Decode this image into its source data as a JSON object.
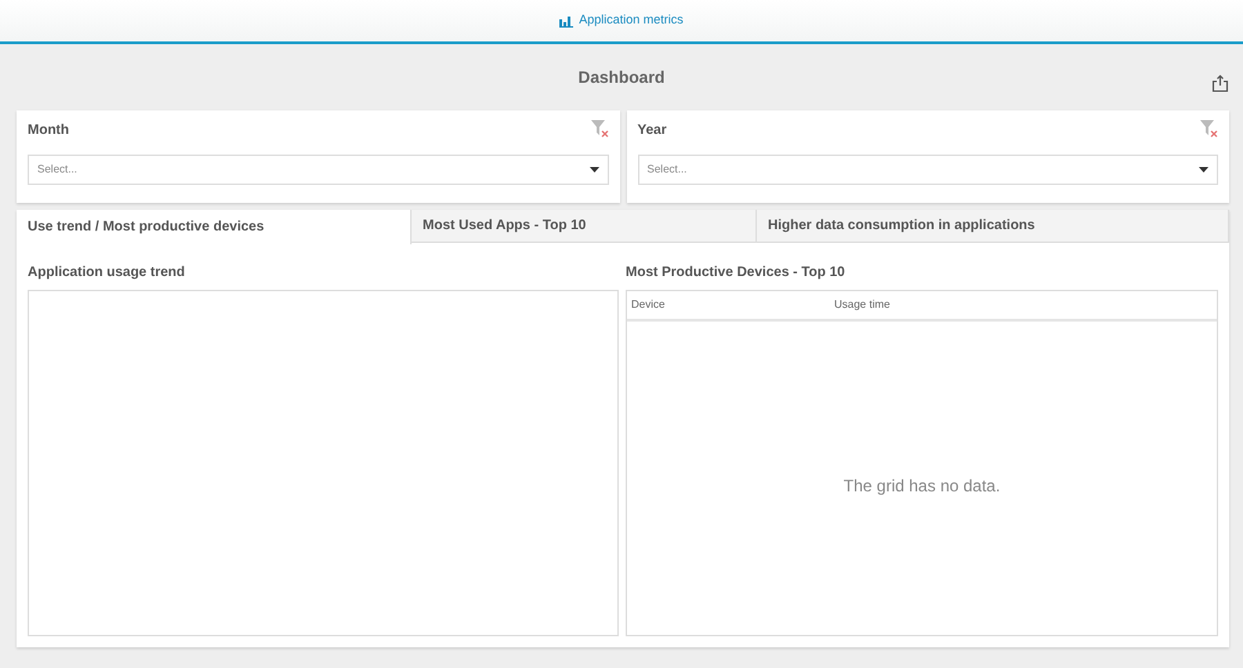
{
  "header": {
    "title": "Application metrics"
  },
  "page": {
    "title": "Dashboard"
  },
  "filters": [
    {
      "label": "Month",
      "placeholder": "Select..."
    },
    {
      "label": "Year",
      "placeholder": "Select..."
    }
  ],
  "tabs": [
    {
      "label": "Use trend / Most productive devices",
      "selected": true
    },
    {
      "label": "Most Used Apps - Top 10",
      "selected": false
    },
    {
      "label": "Higher data consumption in applications",
      "selected": false
    }
  ],
  "trend_panel": {
    "title": "Application usage trend"
  },
  "devices_panel": {
    "title": "Most Productive Devices - Top 10",
    "columns": [
      "Device",
      "Usage time"
    ],
    "empty_message": "The grid has no data."
  }
}
